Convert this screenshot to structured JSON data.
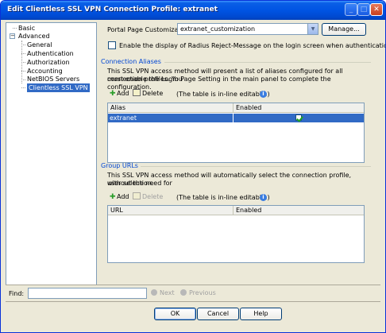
{
  "window": {
    "title": "Edit Clientless SSL VPN Connection Profile: extranet",
    "minimize_icon": "minimize-icon",
    "maximize_icon": "maximize-icon",
    "close_icon": "close-icon"
  },
  "nav": {
    "basic": "Basic",
    "advanced": "Advanced",
    "expander": "−",
    "children": [
      "General",
      "Authentication",
      "Authorization",
      "Accounting",
      "NetBIOS Servers",
      "Clientless SSL VPN"
    ],
    "selected": "Clientless SSL VPN"
  },
  "portal": {
    "label": "Portal Page Customization:",
    "value": "extranet_customization",
    "manage_label": "Manage...",
    "radius_label": "Enable the display of Radius Reject-Message on the login screen when authentication is rejected",
    "radius_checked": false
  },
  "aliases": {
    "heading": "Connection Aliases",
    "description_line1": "This SSL VPN access method will present a list of aliases configured for all connection profiles. You",
    "description_line2": "must enable the Login Page Setting in the main panel to complete the configuration.",
    "add_label": "Add",
    "delete_label": "Delete",
    "editable_note": "(The table is in-line editable.)",
    "columns": [
      "Alias",
      "Enabled"
    ],
    "rows": [
      {
        "alias": "extranet",
        "enabled": true
      }
    ]
  },
  "group_urls": {
    "heading": "Group URLs",
    "description_line1": "This SSL VPN access method will automatically select the connection profile, without the need for",
    "description_line2": "user selection.",
    "add_label": "Add",
    "delete_label": "Delete",
    "editable_note": "(The table is in-line editable.)",
    "columns": [
      "URL",
      "Enabled"
    ]
  },
  "find": {
    "label": "Find:",
    "value": "",
    "next_label": "Next",
    "previous_label": "Previous"
  },
  "buttons": {
    "ok": "OK",
    "cancel": "Cancel",
    "help": "Help"
  }
}
